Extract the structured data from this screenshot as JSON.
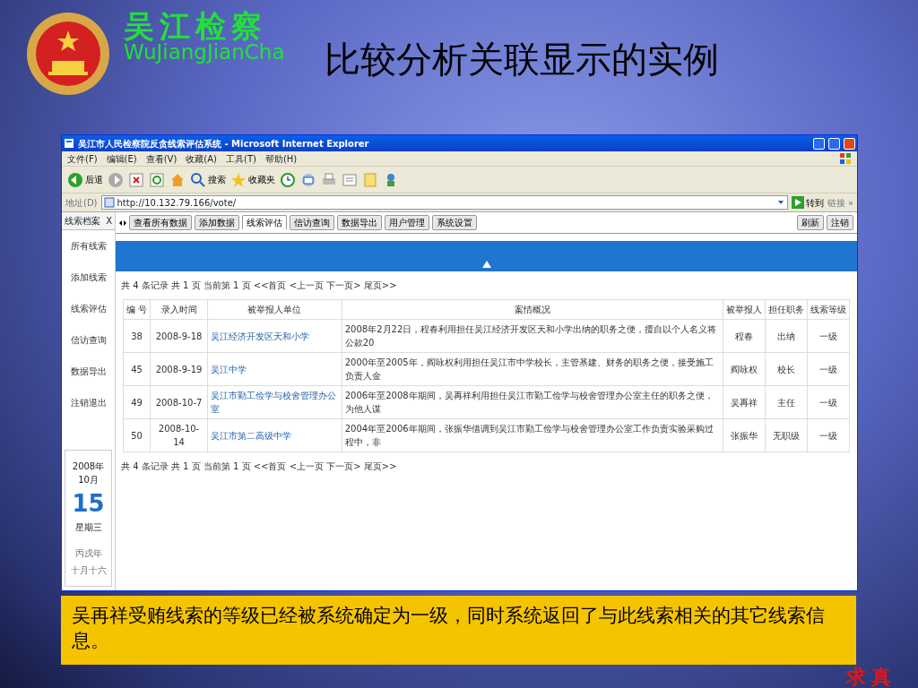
{
  "slide": {
    "brand_cn": "吴江检察",
    "brand_en": "WuJiangJianCha",
    "title": "比较分析关联显示的实例",
    "caption": "吴再祥受贿线索的等级已经被系统确定为一级，同时系统返回了与此线索相关的其它线索信息。",
    "motto": "求真"
  },
  "window": {
    "title": "吴江市人民检察院反贪线索评估系统 - Microsoft Internet Explorer",
    "menu": [
      "文件(F)",
      "编辑(E)",
      "查看(V)",
      "收藏(A)",
      "工具(T)",
      "帮助(H)"
    ],
    "toolbar": [
      {
        "kind": "back",
        "label": "后退"
      },
      {
        "kind": "forward"
      },
      {
        "kind": "stop"
      },
      {
        "kind": "refresh"
      },
      {
        "kind": "home"
      },
      {
        "kind": "search",
        "label": "搜索"
      },
      {
        "kind": "favorites",
        "label": "收藏夹"
      },
      {
        "kind": "history"
      },
      {
        "kind": "mail"
      },
      {
        "kind": "print"
      },
      {
        "kind": "edit"
      },
      {
        "kind": "folder"
      },
      {
        "kind": "messenger"
      }
    ],
    "address": {
      "label": "地址(D)",
      "url": "http://10.132.79.166/vote/",
      "go": "转到",
      "links": "链接 »"
    },
    "sidebar": {
      "title": "线索档案",
      "close": "X",
      "items": [
        "所有线索",
        "添加线索",
        "线索评估",
        "信访查询",
        "数据导出",
        "注销退出"
      ]
    },
    "tabs": [
      {
        "label": "查看所有数据",
        "selected": false
      },
      {
        "label": "添加数据",
        "selected": false
      },
      {
        "label": "线索评估",
        "selected": true
      },
      {
        "label": "信访查询",
        "selected": false
      },
      {
        "label": "数据导出",
        "selected": false
      },
      {
        "label": "用户管理",
        "selected": false
      },
      {
        "label": "系统设置",
        "selected": false
      }
    ],
    "actions": [
      "刷新",
      "注销"
    ],
    "pager_top": "共 4 条记录 共 1 页 当前第 1 页 <<首页 <上一页 下一页> 尾页>>",
    "table": {
      "columns": [
        "编 号",
        "录入时间",
        "被举报人单位",
        "案情概况",
        "被举报人",
        "担任职务",
        "线索等级"
      ],
      "rows": [
        [
          "38",
          "2008-9-18",
          "吴江经济开发区天和小学",
          "2008年2月22日，程春利用担任吴江经济开发区天和小学出纳的职务之便，擅自以个人名义将公款20",
          "程春",
          "出纳",
          "一级"
        ],
        [
          "45",
          "2008-9-19",
          "吴江中学",
          "2000年至2005年，阎咏权利用担任吴江市中学校长，主管基建、财务的职务之便，接受施工负责人金",
          "阎咏权",
          "校长",
          "一级"
        ],
        [
          "49",
          "2008-10-7",
          "吴江市勤工俭学与校舍管理办公室",
          "2006年至2008年期间，吴再祥利用担任吴江市勤工俭学与校舍管理办公室主任的职务之便，为他人谋",
          "吴再祥",
          "主任",
          "一级"
        ],
        [
          "50",
          "2008-10-14",
          "吴江市第二高级中学",
          "2004年至2006年期间，张振华借调到吴江市勤工俭学与校舍管理办公室工作负责实验采购过程中，非",
          "张振华",
          "无职级",
          "一级"
        ]
      ]
    },
    "pager_bottom": "共 4 条记录 共 1 页 当前第 1 页 <<首页 <上一页 下一页> 尾页>>",
    "calendar": {
      "month": "2008年10月",
      "day": "15",
      "weekday": "星期三",
      "lunar_year": "丙戌年",
      "lunar_date": "十月十六"
    }
  }
}
